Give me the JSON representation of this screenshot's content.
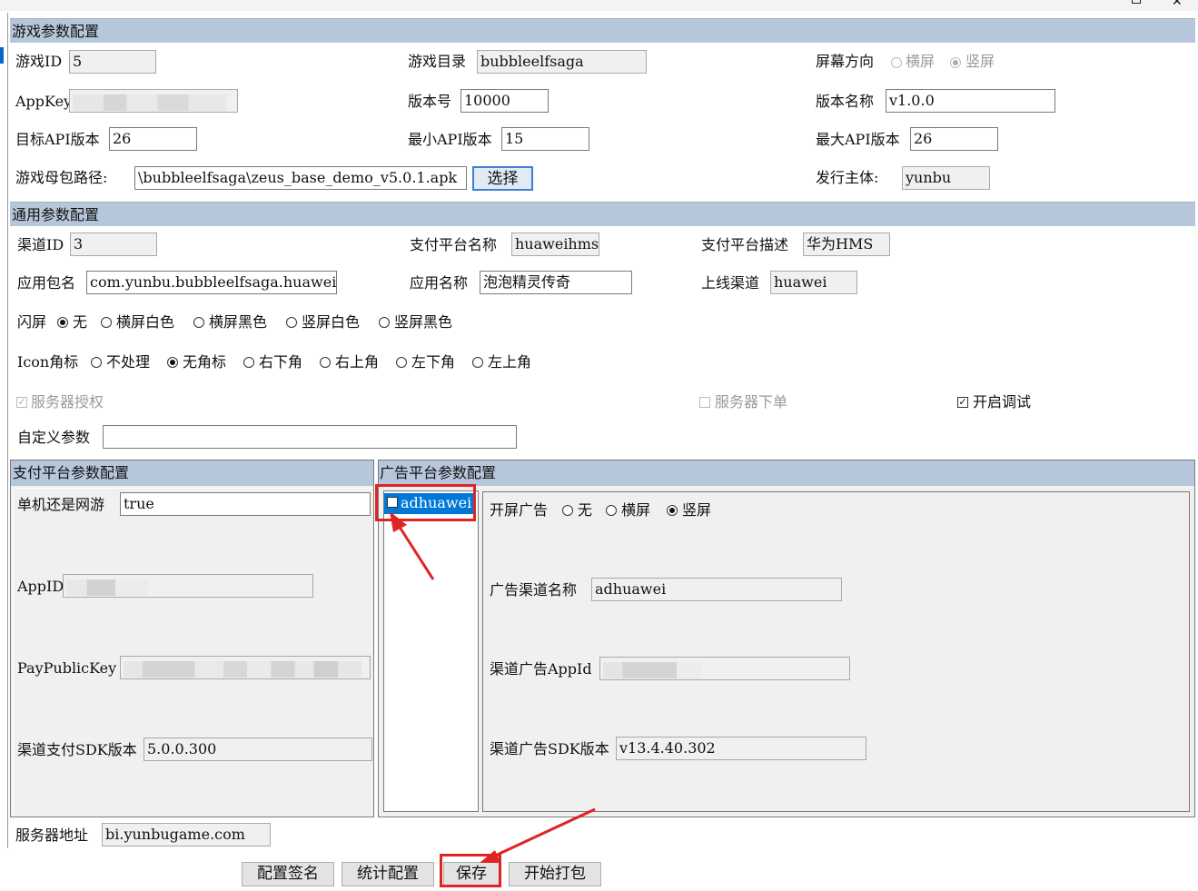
{
  "game_section": {
    "title": "游戏参数配置",
    "game_id_label": "游戏ID",
    "game_id": "5",
    "game_dir_label": "游戏目录",
    "game_dir": "bubbleelfsaga",
    "orientation_label": "屏幕方向",
    "orientation_landscape": "横屏",
    "orientation_portrait": "竖屏",
    "appkey_label": "AppKey",
    "version_label": "版本号",
    "version": "10000",
    "version_name_label": "版本名称",
    "version_name": "v1.0.0",
    "target_api_label": "目标API版本",
    "target_api": "26",
    "min_api_label": "最小API版本",
    "min_api": "15",
    "max_api_label": "最大API版本",
    "max_api": "26",
    "apk_path_label": "游戏母包路径:",
    "apk_path": "\\bubbleelfsaga\\zeus_base_demo_v5.0.1.apk",
    "choose_button": "选择",
    "publisher_label": "发行主体:",
    "publisher": "yunbu"
  },
  "common_section": {
    "title": "通用参数配置",
    "channel_id_label": "渠道ID",
    "channel_id": "3",
    "pay_name_label": "支付平台名称",
    "pay_name": "huaweihms",
    "pay_desc_label": "支付平台描述",
    "pay_desc": "华为HMS",
    "package_label": "应用包名",
    "package": "com.yunbu.bubbleelfsaga.huawei",
    "app_name_label": "应用名称",
    "app_name": "泡泡精灵传奇",
    "online_channel_label": "上线渠道",
    "online_channel": "huawei",
    "splash_label": "闪屏",
    "splash_options": [
      "无",
      "横屏白色",
      "横屏黑色",
      "竖屏白色",
      "竖屏黑色"
    ],
    "icon_label": "Icon角标",
    "icon_options": [
      "不处理",
      "无角标",
      "右下角",
      "右上角",
      "左下角",
      "左上角"
    ],
    "server_auth": "服务器授权",
    "server_order": "服务器下单",
    "debug": "开启调试",
    "custom_label": "自定义参数",
    "custom_value": ""
  },
  "pay_section": {
    "title": "支付平台参数配置",
    "online_label": "单机还是网游",
    "online_value": "true",
    "appid_label": "AppID",
    "pubkey_label": "PayPublicKey",
    "sdk_label": "渠道支付SDK版本",
    "sdk_value": "5.0.0.300"
  },
  "ad_section": {
    "title": "广告平台参数配置",
    "list_item": "adhuawei",
    "splash_label": "开屏广告",
    "splash_options": [
      "无",
      "横屏",
      "竖屏"
    ],
    "channel_name_label": "广告渠道名称",
    "channel_name": "adhuawei",
    "appid_label": "渠道广告AppId",
    "sdk_label": "渠道广告SDK版本",
    "sdk_value": "v13.4.40.302"
  },
  "server_label": "服务器地址",
  "server_value": "bi.yunbugame.com",
  "buttons": {
    "sign": "配置签名",
    "stats": "统计配置",
    "save": "保存",
    "build": "开始打包"
  },
  "colors": {
    "section_bar": "#b6c7dc",
    "selection": "#0078d7",
    "annotation": "#e02424"
  }
}
